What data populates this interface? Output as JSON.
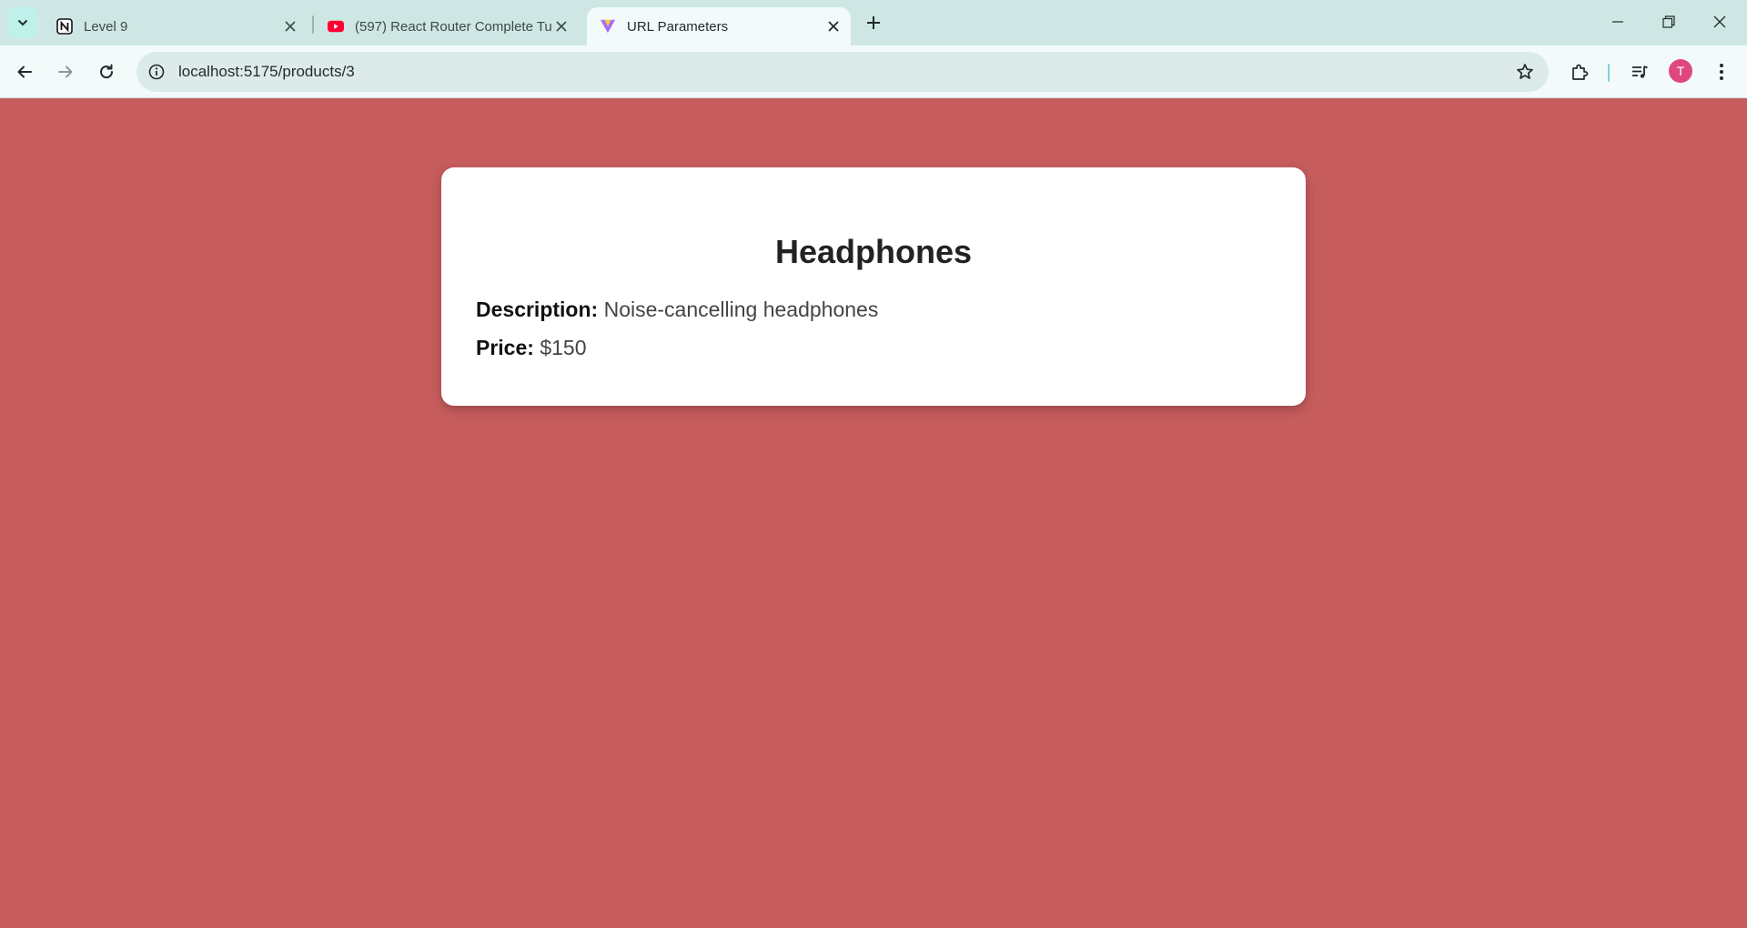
{
  "tabs": [
    {
      "title": "Level 9",
      "favicon": "notion-icon",
      "active": false
    },
    {
      "title": "(597) React Router Complete Tu",
      "favicon": "youtube-icon",
      "active": false
    },
    {
      "title": "URL Parameters",
      "favicon": "vite-icon",
      "active": true
    }
  ],
  "toolbar": {
    "url": "localhost:5175/products/3",
    "profile_initial": "T"
  },
  "product": {
    "name": "Headphones",
    "description_label": "Description:",
    "description": "Noise-cancelling headphones",
    "price_label": "Price:",
    "price": "$150"
  },
  "colors": {
    "page_background": "#c65c5c",
    "card_background": "#ffffff",
    "tabstrip": "#cfe7e4",
    "avatar": "#e0477f"
  }
}
